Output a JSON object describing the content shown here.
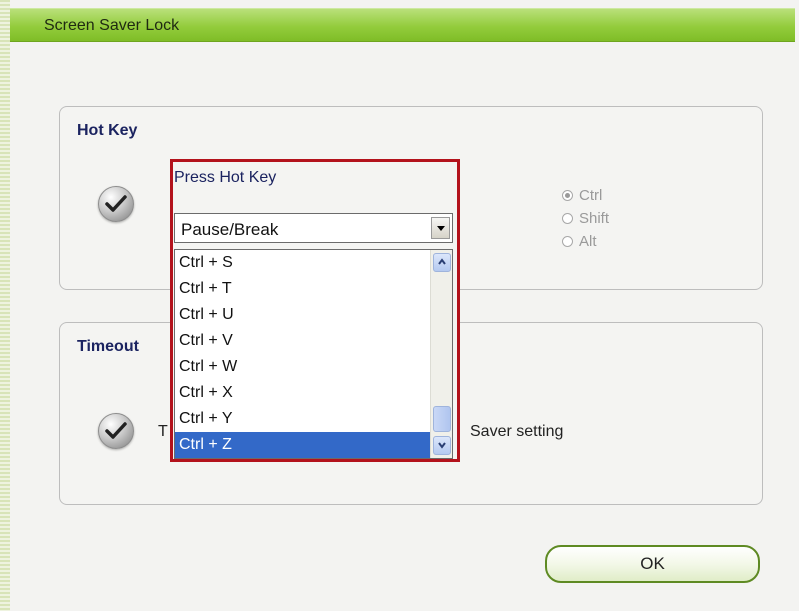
{
  "window": {
    "title": "Screen Saver Lock"
  },
  "hotkey_group": {
    "title": "Hot Key",
    "press_label": "Press Hot Key",
    "combo_value": "Pause/Break",
    "dropdown_items": [
      "Ctrl + S",
      "Ctrl + T",
      "Ctrl + U",
      "Ctrl + V",
      "Ctrl + W",
      "Ctrl + X",
      "Ctrl + Y",
      "Ctrl + Z"
    ],
    "selected_item": "Ctrl + Z",
    "modifiers": [
      {
        "label": "Ctrl",
        "selected": true
      },
      {
        "label": "Shift",
        "selected": false
      },
      {
        "label": "Alt",
        "selected": false
      }
    ]
  },
  "timeout_group": {
    "title": "Timeout",
    "text_prefix": "T",
    "text_suffix": "Saver setting"
  },
  "buttons": {
    "ok": "OK"
  },
  "colors": {
    "titlebar_green": "#93cc3c",
    "highlight_red": "#b3121c",
    "selection_blue": "#3369c8",
    "group_title": "#1b2360"
  },
  "icons": [
    "checkmark-icon",
    "chevron-up-icon",
    "chevron-down-icon",
    "dropdown-arrow-icon"
  ]
}
